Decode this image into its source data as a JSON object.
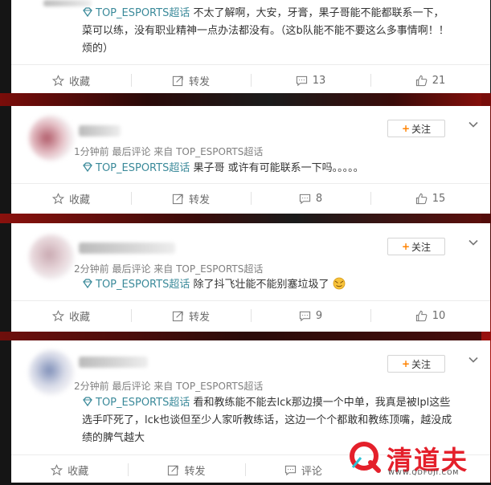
{
  "topic_label": "TOP_ESPORTS超话",
  "follow_label": "关注",
  "actions": {
    "favorite": "收藏",
    "repost": "转发",
    "comment": "评论"
  },
  "posts": [
    {
      "text_line1": "不太了解啊，大安，牙膏，果子哥能不能都联系一下，",
      "text_line2": "菜可以练，没有职业精神一点办法都没有。（这b队能不能不要这么多事情啊！！",
      "text_line3": "烦的）",
      "comment_count": "13",
      "like_count": "21"
    },
    {
      "meta": "1分钟前 最后评论 来自 TOP_ESPORTS超话",
      "text": "果子哥 或许有可能联系一下吗。。。。。",
      "comment_count": "8",
      "like_count": "15"
    },
    {
      "meta": "2分钟前 最后评论 来自 TOP_ESPORTS超话",
      "text": "除了抖飞壮能不能别塞垃圾了",
      "comment_count": "9",
      "like_count": "10"
    },
    {
      "meta": "2分钟前 最后评论 来自 TOP_ESPORTS超话",
      "text_line1": "看和教练能不能去lck那边摸一个中单，我真是被lpl这些",
      "text_line2": "选手吓死了，lck也谈但至少人家听教练话，这边一个个都敢和教练顶嘴，越没成",
      "text_line3": "绩的脾气越大"
    }
  ],
  "watermark": {
    "name": "清道夫",
    "url": "WWW.QDFUJI.COM"
  },
  "colors": {
    "topic": "#3b8a9a",
    "follow_plus": "#ff8200",
    "watermark": "#e4202b"
  }
}
